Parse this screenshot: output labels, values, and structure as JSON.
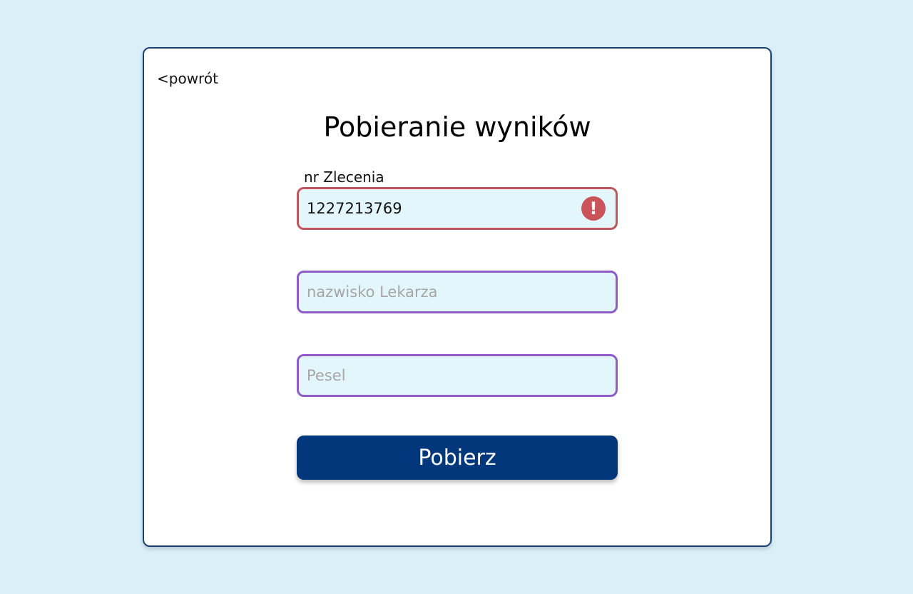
{
  "nav": {
    "back_label": "<powrót"
  },
  "page": {
    "title": "Pobieranie wyników"
  },
  "form": {
    "order_number": {
      "label": "nr Zlecenia",
      "value": "1227213769",
      "state": "error",
      "icon": "exclamation-icon"
    },
    "doctor_surname": {
      "placeholder": "nazwisko Lekarza",
      "value": ""
    },
    "pesel": {
      "placeholder": "Pesel",
      "value": ""
    },
    "submit_label": "Pobierz"
  },
  "colors": {
    "background": "#daf0f9",
    "card_border": "#1c3f73",
    "field_fill": "#e3f6fc",
    "field_border": "#8e5bc8",
    "error": "#c9555a",
    "button": "#03377c"
  }
}
